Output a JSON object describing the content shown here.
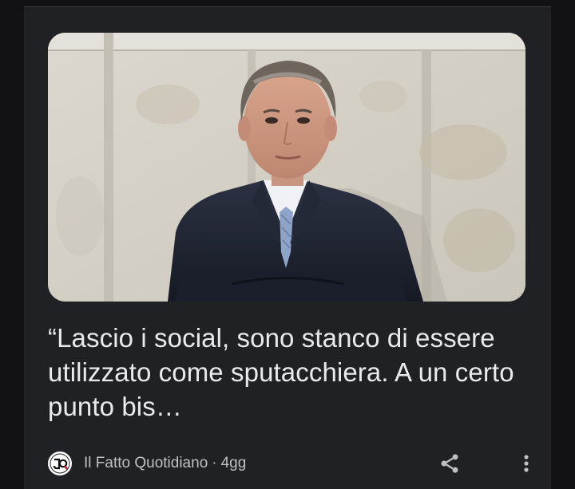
{
  "card": {
    "headline": "“Lascio i social, sono stanco di essere utilizzato come sputacchiera. A un certo punto bis…",
    "source_name": "Il Fatto Quotidiano",
    "separator": "·",
    "age": "4gg"
  },
  "icons": {
    "source_logo": "il-fatto-quotidiano-logo",
    "share": "share-icon",
    "more": "more-vert-icon"
  },
  "colors": {
    "background": "#121214",
    "card": "#202124",
    "headline_text": "#e8eaed",
    "meta_text": "#bdc1c6"
  }
}
